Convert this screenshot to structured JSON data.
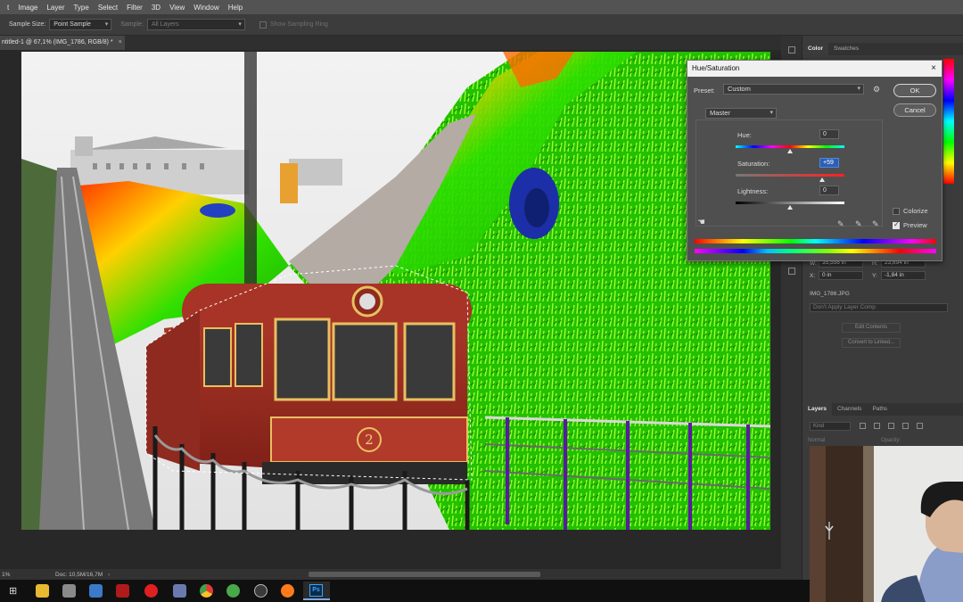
{
  "menu": [
    "t",
    "Image",
    "Layer",
    "Type",
    "Select",
    "Filter",
    "3D",
    "View",
    "Window",
    "Help"
  ],
  "options_bar": {
    "sample_size_label": "Sample Size:",
    "sample_size_value": "Point Sample",
    "sample_label": "Sample:",
    "sample_value": "All Layers",
    "show_ring_label": "Show Sampling Ring"
  },
  "document_tab": {
    "title": "ntitled-1 @ 67,1% (IMG_1786, RGB/8) *",
    "close": "×"
  },
  "status_bar": {
    "zoom": "1%",
    "doc": "Doc: 10,5M/16,7M",
    "arrow": "›"
  },
  "panels": {
    "color_tab": "Color",
    "swatches_tab": "Swatches",
    "layers_tab": "Layers",
    "channels_tab": "Channels",
    "paths_tab": "Paths"
  },
  "properties": {
    "w_label": "W:",
    "w_value": "35,556 in",
    "h_label": "H:",
    "h_value": "23,694 in",
    "x_label": "X:",
    "x_value": "0 in",
    "y_label": "Y:",
    "y_value": "-1,84 in",
    "file_name": "IMG_1786.JPG",
    "layer_comp": "Don't Apply Layer Comp",
    "edit_contents": "Edit Contents",
    "convert_linked": "Convert to Linked..."
  },
  "layers_panel": {
    "filter_kind": "Kind",
    "blend_mode": "Normal",
    "opacity_label": "Opacity:"
  },
  "hue_saturation": {
    "title": "Hue/Saturation",
    "close": "×",
    "preset_label": "Preset:",
    "preset_value": "Custom",
    "ok_label": "OK",
    "cancel_label": "Cancel",
    "channel_value": "Master",
    "hue_label": "Hue:",
    "hue_value": "0",
    "saturation_label": "Saturation:",
    "saturation_value": "+59",
    "lightness_label": "Lightness:",
    "lightness_value": "0",
    "colorize_label": "Colorize",
    "colorize_checked": false,
    "preview_label": "Preview",
    "preview_checked": true,
    "hue_slider_fraction": 0.5,
    "saturation_slider_fraction": 0.795,
    "lightness_slider_fraction": 0.5
  },
  "canvas": {
    "tram_number": "2"
  },
  "taskbar": {
    "icons": [
      "task-view-icon",
      "file-explorer-icon",
      "app-icon",
      "app-icon",
      "app-icon",
      "app-icon",
      "app-icon",
      "chrome-icon",
      "app-icon",
      "app-icon",
      "firefox-icon",
      "photoshop-icon"
    ],
    "photoshop_label": "Ps"
  }
}
